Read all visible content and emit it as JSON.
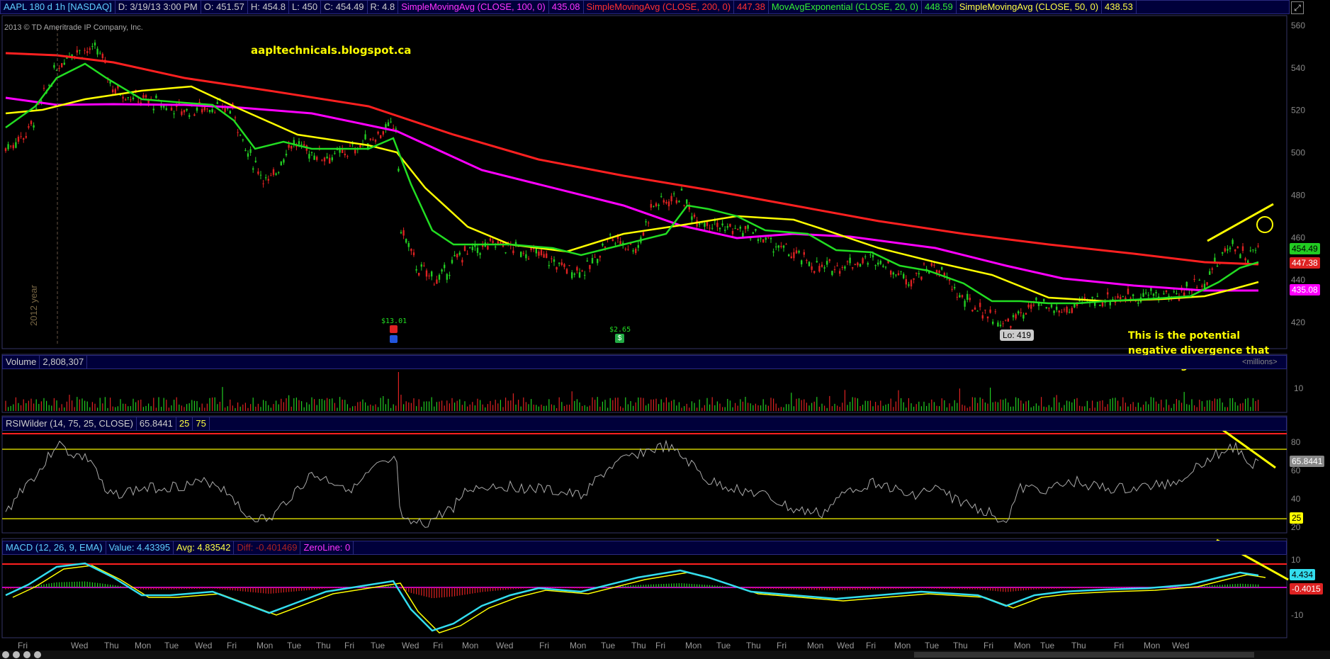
{
  "header": {
    "symbol": "AAPL 180 d 1h [NASDAQ]",
    "date": "D: 3/19/13 3:00 PM",
    "open": "O: 451.57",
    "high": "H: 454.8",
    "low": "L: 450",
    "close": "C: 454.49",
    "range": "R: 4.8",
    "sma100_label": "SimpleMovingAvg (CLOSE, 100, 0)",
    "sma100_value": "435.08",
    "sma200_label": "SimpleMovingAvg (CLOSE, 200, 0)",
    "sma200_value": "447.38",
    "ema20_label": "MovAvgExponential (CLOSE, 20, 0)",
    "ema20_value": "448.59",
    "sma50_label": "SimpleMovingAvg (CLOSE, 50, 0)",
    "sma50_value": "438.53"
  },
  "copyright": "2013 © TD Ameritrade IP Company, Inc.",
  "blog_url": "aapltechnicals.blogspot.ca",
  "year_marker": "2012 year",
  "dividend1": "$13.01",
  "dividend2": "$2.65",
  "low_label": "Lo: 419",
  "annotation": [
    "This is the potential",
    "negative divergence that",
    "I'm talking about"
  ],
  "price_axis": [
    "560",
    "540",
    "520",
    "500",
    "480",
    "460",
    "440",
    "420"
  ],
  "price_chips": {
    "ema20": "454.49",
    "sma200": "447.38",
    "sma100": "435.08"
  },
  "volume": {
    "label": "Volume",
    "value": "2,808,307",
    "units": "<millions>",
    "axis": [
      "10"
    ]
  },
  "rsi": {
    "label": "RSIWilder (14, 75, 25, CLOSE)",
    "value": "65.8441",
    "oversold": "25",
    "overbought": "75",
    "axis": [
      "80",
      "60",
      "40",
      "20"
    ],
    "chip": "65.8441",
    "chip25": "25"
  },
  "macd": {
    "label": "MACD (12, 26, 9, EMA)",
    "value": "Value: 4.43395",
    "avg": "Avg: 4.83542",
    "diff": "Diff: -0.401469",
    "zero": "ZeroLine: 0",
    "axis": [
      "10",
      "-10"
    ],
    "chip_value": "4.434",
    "chip_diff": "-0.4015"
  },
  "time_axis": [
    "Fri",
    "Wed",
    "Thu",
    "Mon",
    "Tue",
    "Wed",
    "Fri",
    "Mon",
    "Tue",
    "Thu",
    "Fri",
    "Tue",
    "Wed",
    "Fri",
    "Mon",
    "Wed",
    "Fri",
    "Mon",
    "Tue",
    "Thu",
    "Fri",
    "Mon",
    "Tue",
    "Thu",
    "Fri",
    "Mon",
    "Wed",
    "Fri",
    "Mon",
    "Tue",
    "Thu",
    "Fri",
    "Mon",
    "Tue",
    "Thu",
    "Fri",
    "Mon",
    "Wed"
  ],
  "colors": {
    "sma100": "#ff00ff",
    "sma200": "#ff2020",
    "ema20": "#22dd22",
    "sma50": "#ffff00",
    "up": "#22cc22",
    "down": "#dd2222",
    "panel": "#00003a"
  }
}
